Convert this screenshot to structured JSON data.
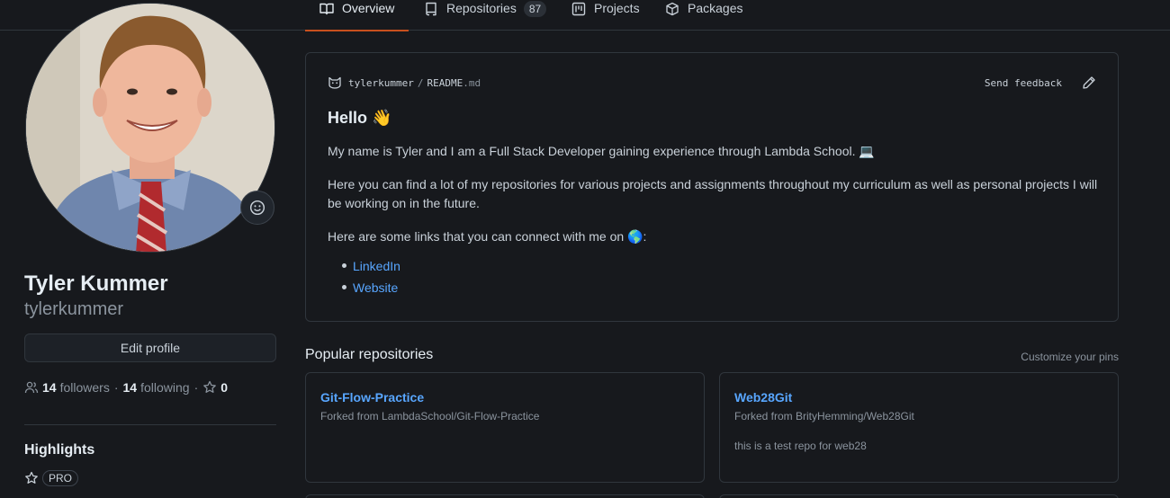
{
  "tabs": [
    {
      "label": "Overview",
      "icon": "book-icon",
      "active": true
    },
    {
      "label": "Repositories",
      "icon": "repo-icon",
      "count": "87"
    },
    {
      "label": "Projects",
      "icon": "project-icon"
    },
    {
      "label": "Packages",
      "icon": "package-icon"
    }
  ],
  "profile": {
    "full_name": "Tyler Kummer",
    "login": "tylerkummer",
    "edit_label": "Edit profile",
    "followers_count": "14",
    "followers_label": "followers",
    "following_count": "14",
    "following_label": "following",
    "stars_count": "0",
    "highlights_title": "Highlights",
    "pro_badge": "PRO"
  },
  "readme": {
    "owner": "tylerkummer",
    "file": "README",
    "ext": ".md",
    "feedback": "Send feedback",
    "heading": "Hello 👋",
    "para1": "My name is Tyler and I am a Full Stack Developer gaining experience through Lambda School. 💻",
    "para2": "Here you can find a lot of my repositories for various projects and assignments throughout my curriculum as well as personal projects I will be working on in the future.",
    "para3": "Here are some links that you can connect with me on 🌎:",
    "links": [
      "LinkedIn",
      "Website"
    ]
  },
  "popular": {
    "title": "Popular repositories",
    "customize": "Customize your pins",
    "repos": [
      {
        "name": "Git-Flow-Practice",
        "fork": "Forked from LambdaSchool/Git-Flow-Practice",
        "desc": ""
      },
      {
        "name": "Web28Git",
        "fork": "Forked from BrityHemming/Web28Git",
        "desc": "this is a test repo for web28"
      }
    ]
  },
  "colors": {
    "accent_tab": "#c8501e",
    "link": "#58a6ff",
    "background": "#17191d"
  }
}
